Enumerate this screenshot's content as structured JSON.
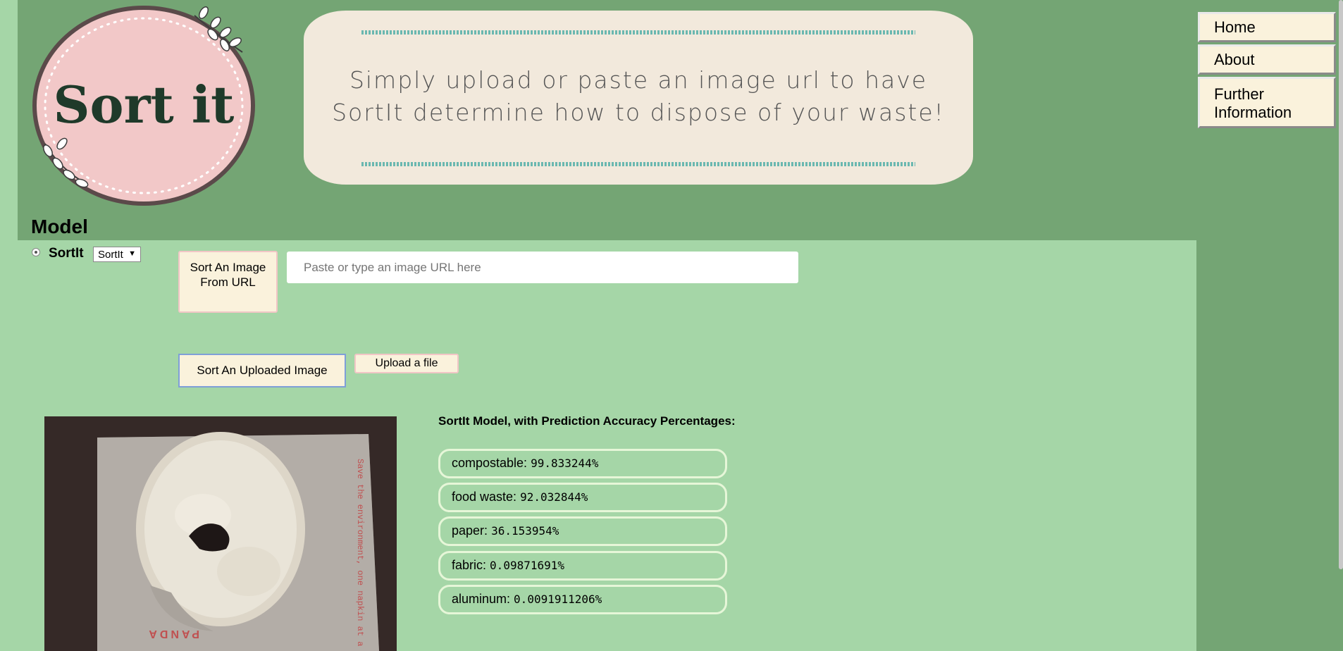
{
  "logo": {
    "text": "Sort it"
  },
  "banner": {
    "line1": "Simply upload or paste an image url to have",
    "line2": "SortIt determine how to dispose of your waste!"
  },
  "nav": {
    "items": [
      "Home",
      "About",
      "Further Information"
    ]
  },
  "model": {
    "title": "Model",
    "radio_label": "SortIt",
    "select_value": "SortIt"
  },
  "controls": {
    "sort_url_button": "Sort An Image From URL",
    "url_placeholder": "Paste or type an image URL here",
    "sort_uploaded_button": "Sort An Uploaded Image",
    "upload_file_button": "Upload a file"
  },
  "photo": {
    "caption_text": "Save the environment, one napkin at a time",
    "brand": "PANDA"
  },
  "results": {
    "title": "SortIt Model, with Prediction Accuracy Percentages:",
    "items": [
      {
        "label": "compostable:",
        "value": "99.833244%"
      },
      {
        "label": "food waste:",
        "value": "92.032844%"
      },
      {
        "label": "paper:",
        "value": "36.153954%"
      },
      {
        "label": "fabric:",
        "value": "0.09871691%"
      },
      {
        "label": "aluminum:",
        "value": "0.0091911206%"
      }
    ]
  },
  "colors": {
    "header": "#74a574",
    "body": "#a5d6a7",
    "logo_pink": "#f2c8c8",
    "button_cream": "#faf2dc"
  }
}
